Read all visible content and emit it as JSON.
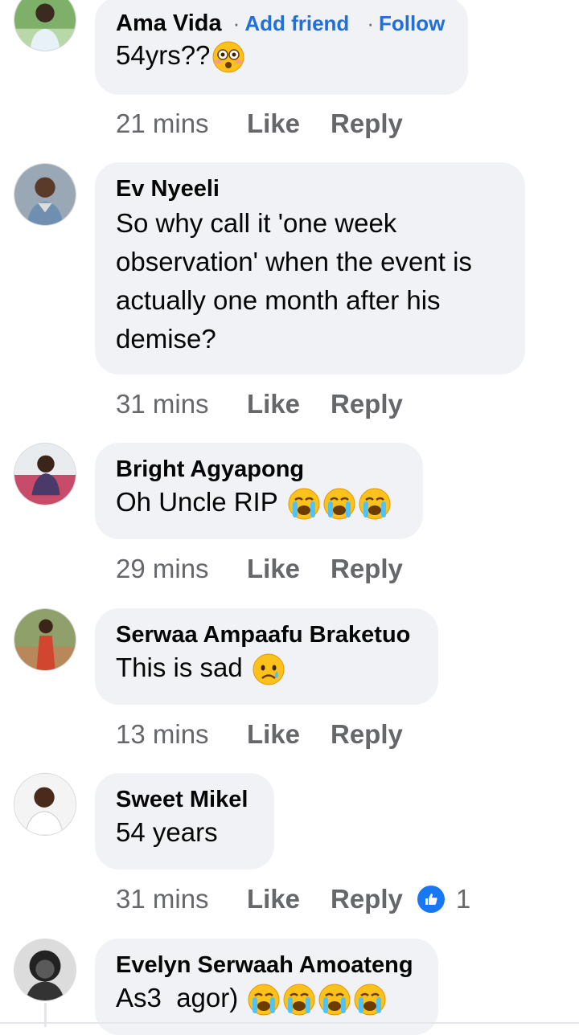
{
  "comments": [
    {
      "name": "Ama Vida",
      "add_friend": "Add friend",
      "follow": "Follow",
      "text": "54yrs??",
      "emoji": "flushed-face-emoji",
      "time": "21 mins",
      "like": "Like",
      "reply": "Reply"
    },
    {
      "name": "Ev Nyeeli",
      "lines": [
        "So why call it 'one week",
        "observation' when the event is",
        "actually one month after his",
        "demise?"
      ],
      "time": "31 mins",
      "like": "Like",
      "reply": "Reply"
    },
    {
      "name": "Bright Agyapong",
      "text": "Oh Uncle RIP",
      "emoji": "loudly-crying-face-emoji",
      "time": "29 mins",
      "like": "Like",
      "reply": "Reply"
    },
    {
      "name": "Serwaa Ampaafu Braketuo",
      "text": "This is sad",
      "emoji": "sad-tear-face-emoji",
      "time": "13 mins",
      "like": "Like",
      "reply": "Reply"
    },
    {
      "name": "Sweet Mikel",
      "text": "54 years",
      "time": "31 mins",
      "like": "Like",
      "reply": "Reply",
      "reaction_count": "1",
      "reaction_icon": "thumbs-up-icon"
    },
    {
      "name": "Evelyn Serwaah Amoateng",
      "text": "As3  agor)",
      "emoji": "loudly-crying-face-emoji"
    }
  ],
  "colors": {
    "bubble": "#f0f2f5",
    "link": "#216fdb",
    "meta": "#65676b",
    "reaction": "#1877f2"
  }
}
